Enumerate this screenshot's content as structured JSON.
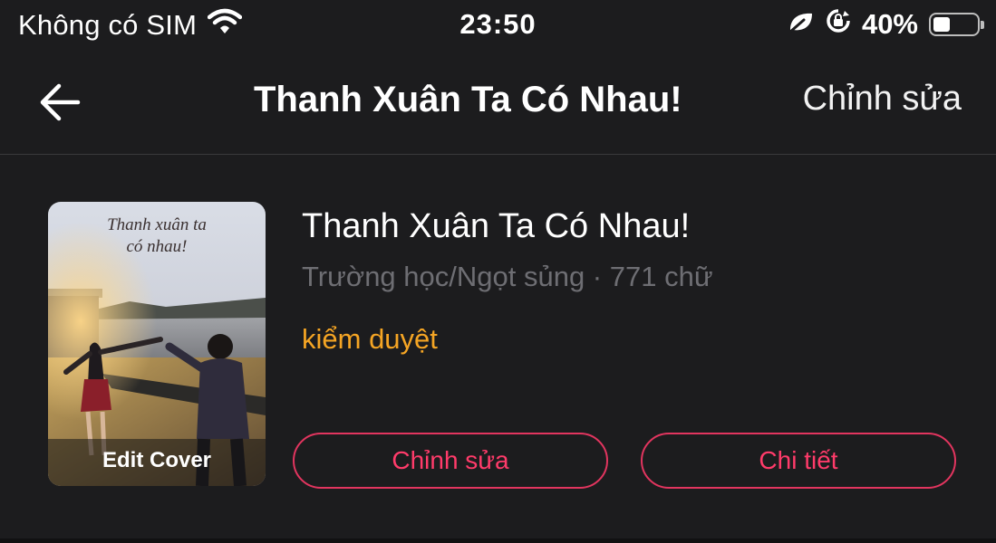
{
  "status_bar": {
    "carrier": "Không có SIM",
    "time": "23:50",
    "battery_percent": "40%",
    "battery_level": 0.4,
    "icons": [
      "wifi-icon",
      "leaf-icon",
      "orientation-lock-icon",
      "battery-icon"
    ]
  },
  "nav": {
    "back_icon": "arrow-left-icon",
    "title": "Thanh Xuân Ta Có Nhau!",
    "edit_label": "Chỉnh sửa"
  },
  "book": {
    "cover_text_line1": "Thanh xuân ta",
    "cover_text_line2": "có nhau!",
    "edit_cover_label": "Edit Cover",
    "title": "Thanh Xuân Ta Có Nhau!",
    "meta": "Trường học/Ngọt sủng · 771 chữ",
    "status": "kiểm duyệt",
    "edit_button": "Chỉnh sửa",
    "detail_button": "Chi tiết"
  },
  "colors": {
    "background": "#1c1c1e",
    "accent_pink": "#ff3b6a",
    "status_orange": "#f5a524",
    "meta_gray": "#6e6e73"
  }
}
